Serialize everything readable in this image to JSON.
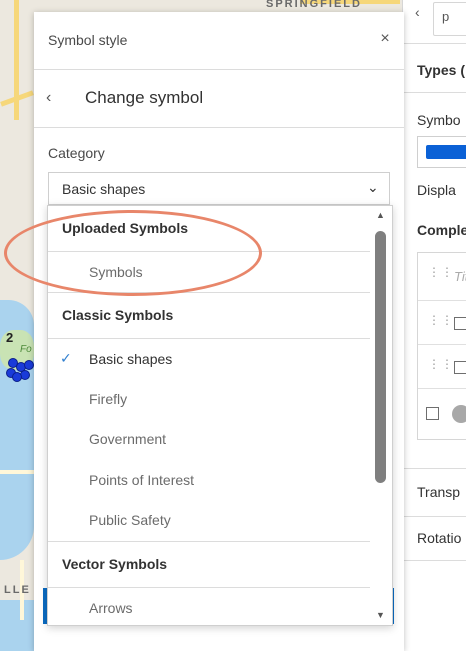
{
  "map": {
    "labels": [
      "SPRINGFIELD",
      "LLE"
    ],
    "marker_label": "2",
    "park_label": "Fo"
  },
  "dialog": {
    "title": "Symbol style",
    "close_icon": "close-icon",
    "back_title": "Change symbol",
    "category_label": "Category",
    "category_value": "Basic shapes"
  },
  "dropdown": {
    "groups": [
      {
        "label": "Uploaded Symbols",
        "items": [
          {
            "label": "Symbols",
            "selected": false
          }
        ]
      },
      {
        "label": "Classic Symbols",
        "items": [
          {
            "label": "Basic shapes",
            "selected": true
          },
          {
            "label": "Firefly",
            "selected": false
          },
          {
            "label": "Government",
            "selected": false
          },
          {
            "label": "Points of Interest",
            "selected": false
          },
          {
            "label": "Public Safety",
            "selected": false
          }
        ]
      },
      {
        "label": "Vector Symbols",
        "items": [
          {
            "label": "Arrows",
            "selected": false
          }
        ]
      }
    ]
  },
  "right_panel": {
    "tab_partial": "p",
    "types_partial": "Types (",
    "symbol_partial": "Symbo",
    "display_partial": "Displa",
    "complex_partial": "Comple",
    "title_placeholder_partial": "Tit",
    "transparency_partial": "Transp",
    "rotation_partial": "Rotatio"
  },
  "colors": {
    "accent": "#0a6bc2",
    "check": "#2f7fcf",
    "annotation": "#e8866a",
    "symbol_fill": "#0b61d6",
    "map_points": "#1a3bd9"
  }
}
